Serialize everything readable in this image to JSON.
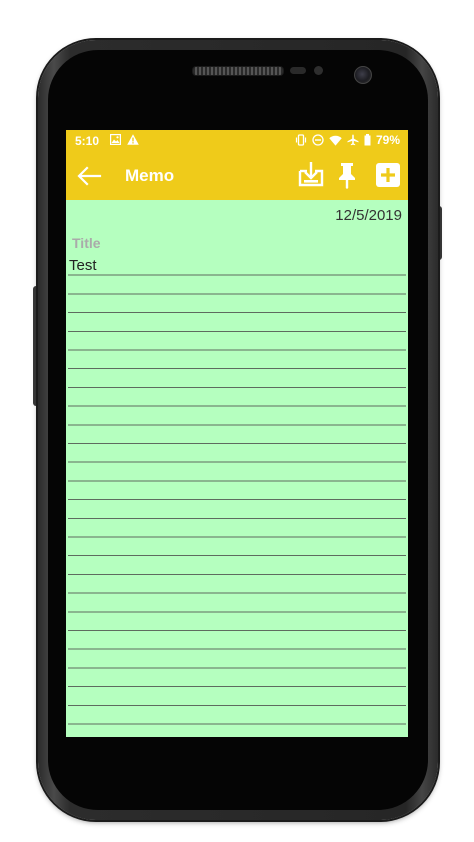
{
  "status_bar": {
    "time": "5:10",
    "battery_percent": "79%",
    "background_color": "#efcb1a",
    "left_icons": [
      "image-notification-icon",
      "warning-icon"
    ],
    "right_icons": [
      "vibrate-icon",
      "do-not-disturb-icon",
      "wifi-icon",
      "airplane-mode-icon",
      "battery-icon"
    ]
  },
  "app_bar": {
    "title": "Memo",
    "back_icon": "arrow-left-icon",
    "actions": [
      "save-download-icon",
      "pin-icon",
      "add-icon"
    ]
  },
  "note": {
    "date": "12/5/2019",
    "title_placeholder": "Title",
    "title_value": "",
    "body_text": "Test",
    "background_color": "#b5ffbf"
  }
}
